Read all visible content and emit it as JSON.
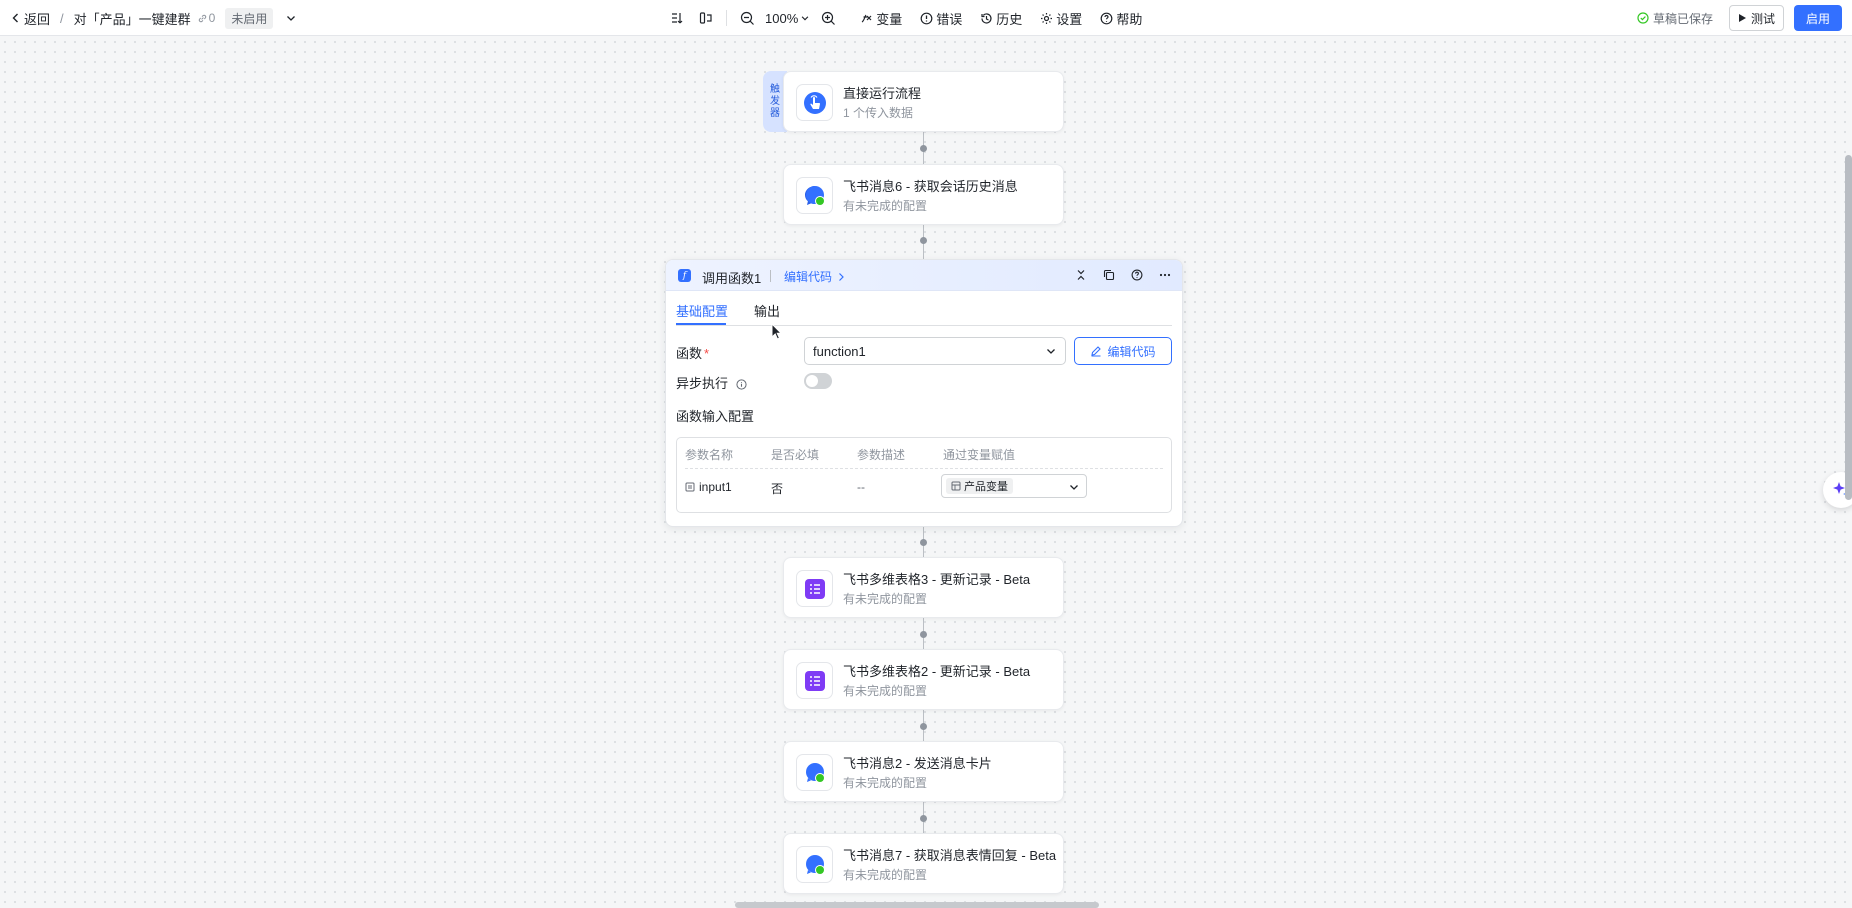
{
  "header": {
    "back_label": "返回",
    "separator": "/",
    "title": "对「产品」一键建群",
    "link_count": "0",
    "status_badge": "未启用",
    "zoom": "100%",
    "menu_variables": "变量",
    "menu_errors": "错误",
    "menu_history": "历史",
    "menu_settings": "设置",
    "menu_help": "帮助",
    "saved_status": "草稿已保存",
    "test_label": "测试",
    "enable_label": "启用"
  },
  "trigger": {
    "tab_label": "触发器",
    "tab_chars": [
      "触",
      "发",
      "器"
    ],
    "title": "直接运行流程",
    "subtitle": "1 个传入数据"
  },
  "nodes": [
    {
      "title": "飞书消息6 - 获取会话历史消息",
      "subtitle": "有未完成的配置",
      "icon": "feishu-message-icon"
    },
    {
      "title": "飞书多维表格3 - 更新记录 - Beta",
      "subtitle": "有未完成的配置",
      "icon": "feishu-bitable-icon"
    },
    {
      "title": "飞书多维表格2 - 更新记录 - Beta",
      "subtitle": "有未完成的配置",
      "icon": "feishu-bitable-icon"
    },
    {
      "title": "飞书消息2 - 发送消息卡片",
      "subtitle": "有未完成的配置",
      "icon": "feishu-message-icon"
    },
    {
      "title": "飞书消息7 - 获取消息表情回复 - Beta",
      "subtitle": "有未完成的配置",
      "icon": "feishu-message-icon"
    }
  ],
  "function_card": {
    "title": "调用函数1",
    "edit_code_link": "编辑代码",
    "tabs": [
      "基础配置",
      "输出"
    ],
    "function_label": "函数",
    "function_value": "function1",
    "edit_code_button": "编辑代码",
    "async_label": "异步执行",
    "async_enabled": false,
    "input_config_label": "函数输入配置",
    "param_headers": [
      "参数名称",
      "是否必填",
      "参数描述",
      "通过变量赋值"
    ],
    "params": [
      {
        "name": "input1",
        "required": "否",
        "description": "--",
        "variable": "产品变量"
      }
    ]
  },
  "colors": {
    "accent": "#3370ff",
    "trigger_tab": "#d6e2ff",
    "bitable": "#7f3bf5",
    "saved_green": "#34c724"
  }
}
